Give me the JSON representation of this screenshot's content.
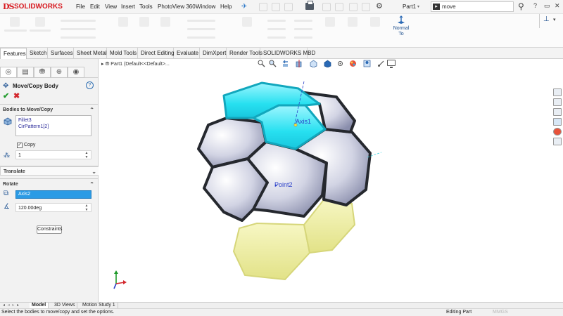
{
  "app": {
    "logo_text": "SOLIDWORKS",
    "logo_ds": "DS"
  },
  "menu": {
    "items": [
      "File",
      "Edit",
      "View",
      "Insert",
      "Tools",
      "PhotoView 360",
      "Window",
      "Help"
    ]
  },
  "header": {
    "doc_title": "Part1",
    "search_value": "move",
    "help_glyph": "?"
  },
  "ribbon": {
    "normal_to_label_1": "Normal",
    "normal_to_label_2": "To"
  },
  "tabs": [
    "Features",
    "Sketch",
    "Surfaces",
    "Sheet Metal",
    "Mold Tools",
    "Direct Editing",
    "Evaluate",
    "DimXpert",
    "Render Tools",
    "SOLIDWORKS MBD"
  ],
  "property_manager": {
    "title": "Move/Copy Body",
    "help_glyph": "?",
    "ok_glyph": "✔",
    "cancel_glyph": "✖",
    "bodies_header": "Bodies to Move/Copy",
    "bodies": [
      "Fillet3",
      "CirPattern1[2]"
    ],
    "copy_label": "Copy",
    "copy_checked": true,
    "copies_value": "1",
    "translate_header": "Translate",
    "rotate_header": "Rotate",
    "axis_value": "Axis2",
    "angle_value": "120.00deg",
    "constraints_label": "Constraints"
  },
  "graphics": {
    "tree_path": "Part1 (Default<<Default>...",
    "label_axis": "Axis1",
    "label_point": "Point2"
  },
  "bottom_tabs": [
    "Model",
    "3D Views",
    "Motion Study 1"
  ],
  "status": {
    "message": "Select the bodies to move/copy and set the options.",
    "mode": "Editing Part",
    "units": "MMGS"
  },
  "colors": {
    "brand_red": "#d71920",
    "highlight_cyan": "#27e0f0",
    "preview_yellow": "#ecec9a",
    "selection_blue": "#2b9be5"
  },
  "icons": {
    "pin": "pushpin-icon",
    "gear": "gear-icon",
    "search": "search-icon",
    "normal_to": "normal-to-icon",
    "triad": "axis-triad-icon"
  }
}
